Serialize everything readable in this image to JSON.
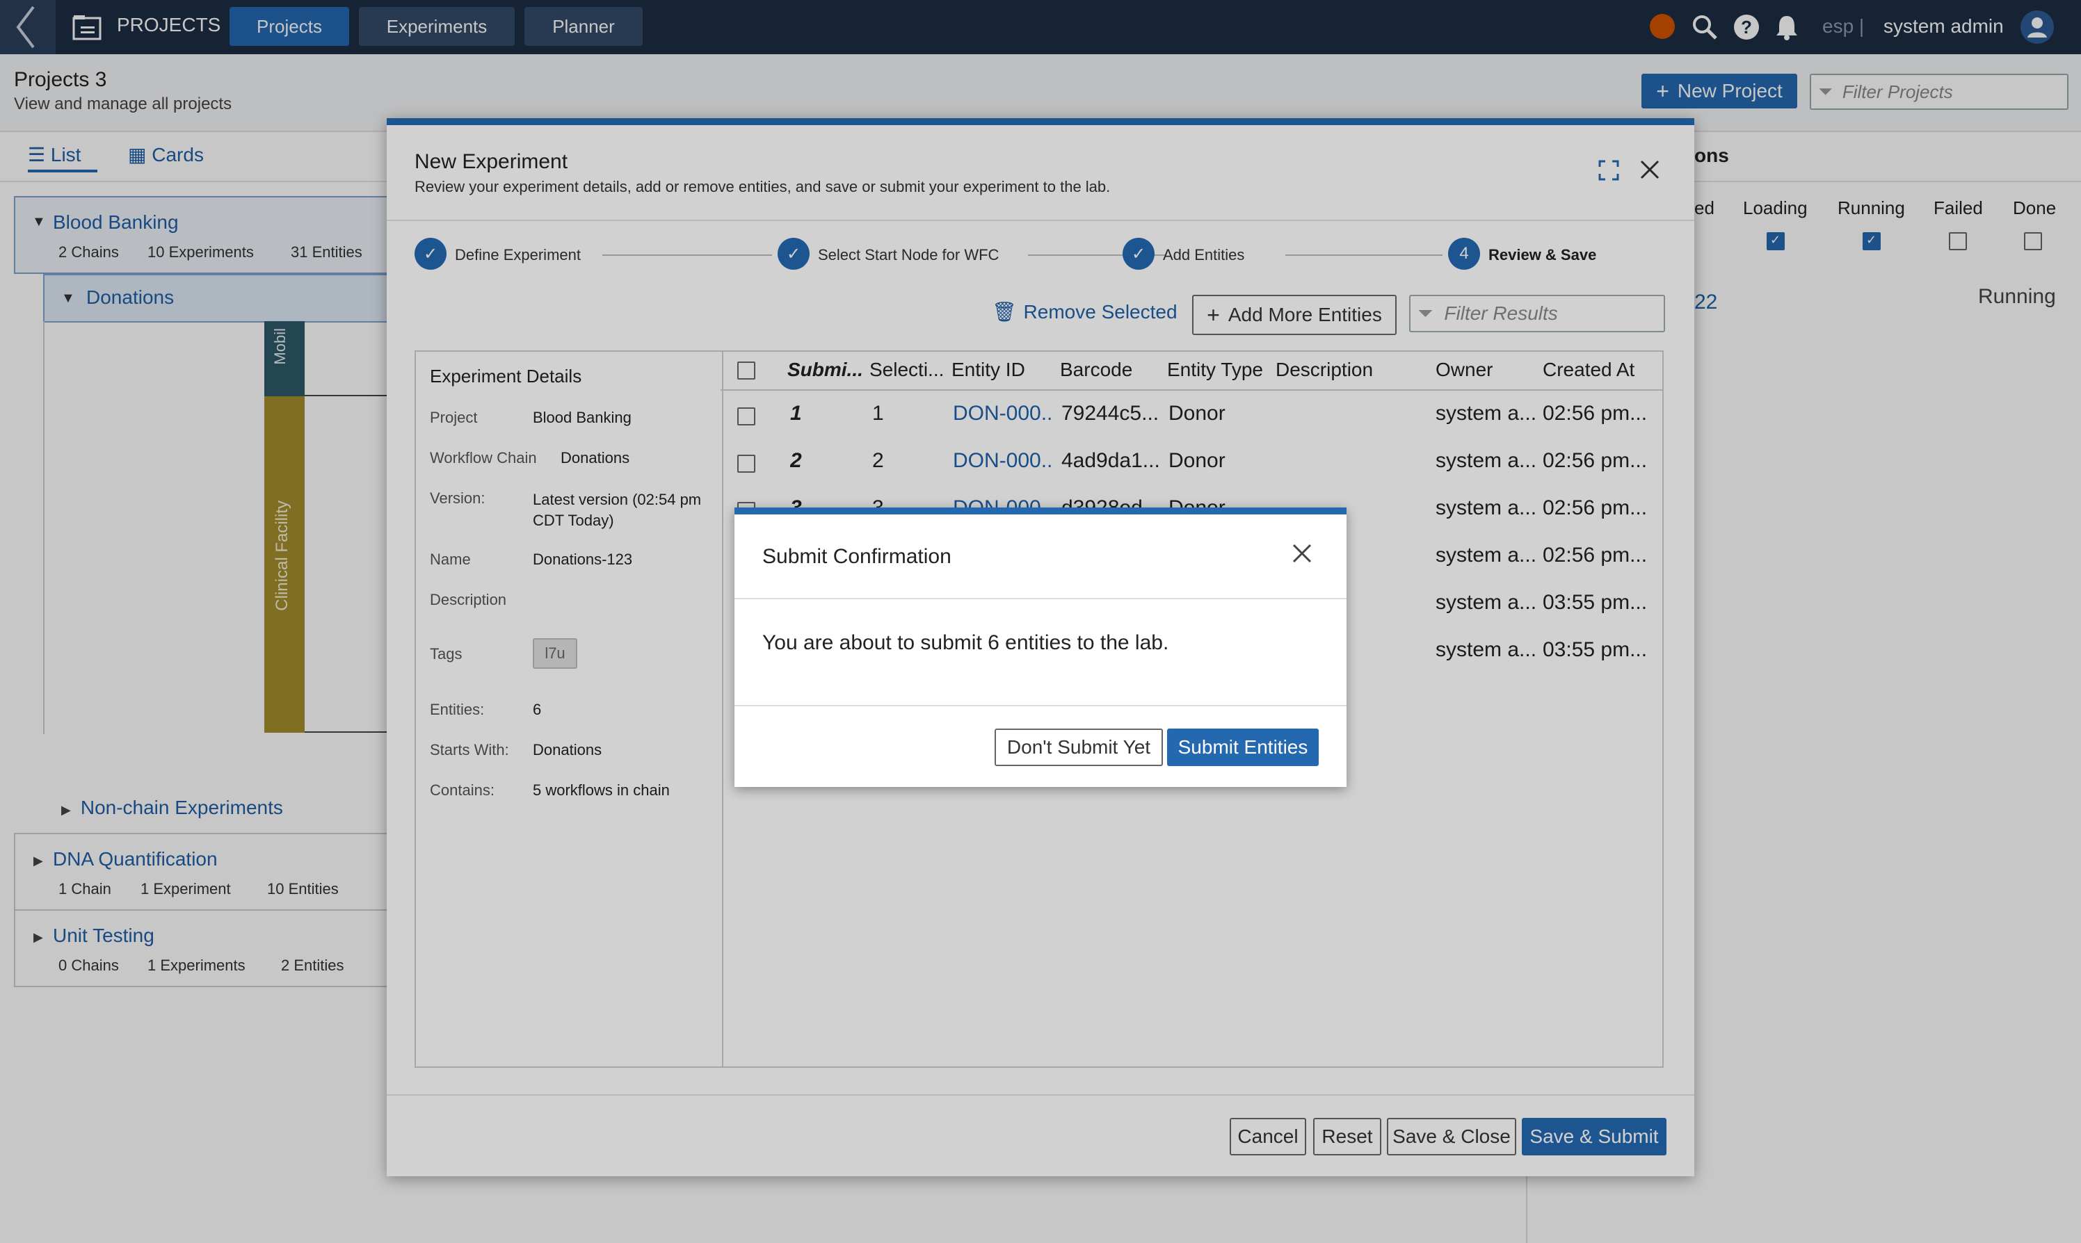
{
  "topbar": {
    "app_title": "PROJECTS",
    "tabs": [
      {
        "label": "Projects",
        "active": true
      },
      {
        "label": "Experiments",
        "active": false
      },
      {
        "label": "Planner",
        "active": false
      }
    ],
    "lang": "esp |",
    "user": "system admin",
    "status_color": "#d35400"
  },
  "page": {
    "title": "Projects 3",
    "subtitle": "View and manage all projects",
    "new_project": "New Project",
    "filter_placeholder": "Filter Projects",
    "view_tabs": [
      "List",
      "Cards"
    ]
  },
  "tree": {
    "blood_banking": {
      "name": "Blood Banking",
      "chains": "2 Chains",
      "experiments": "10 Experiments",
      "entities": "31 Entities"
    },
    "donations": "Donations",
    "lane_mobile": "Mobil",
    "lane_clinical": "Clinical Facility",
    "non_chain": "Non-chain Experiments",
    "dna": {
      "name": "DNA Quantification",
      "chains": "1 Chain",
      "experiments": "1 Experiment",
      "entities": "10 Entities"
    },
    "unit": {
      "name": "Unit Testing",
      "chains": "0 Chains",
      "experiments": "1 Experiments",
      "entities": "2 Entities"
    }
  },
  "right_panel": {
    "header": "ons",
    "cols": [
      "ed",
      "Loading",
      "Running",
      "Failed",
      "Done"
    ],
    "checked": [
      null,
      true,
      true,
      false,
      false
    ],
    "link": "22",
    "status": "Running"
  },
  "modal": {
    "title": "New Experiment",
    "subtitle": "Review your experiment details, add or remove entities, and save or submit your experiment to the lab.",
    "steps": [
      {
        "label": "Define Experiment",
        "done": true,
        "num": ""
      },
      {
        "label": "Select Start Node for WFC",
        "done": true,
        "num": ""
      },
      {
        "label": "Add Entities",
        "done": true,
        "num": ""
      },
      {
        "label": "Review & Save",
        "done": false,
        "num": "4"
      }
    ],
    "remove_selected": "Remove Selected",
    "add_more": "Add More Entities",
    "filter_placeholder": "Filter Results",
    "details": {
      "heading": "Experiment Details",
      "rows": [
        {
          "label": "Project",
          "value": "Blood Banking"
        },
        {
          "label": "Workflow Chain",
          "value": "Donations"
        },
        {
          "label": "Version:",
          "value": "Latest version (02:54 pm CDT Today)"
        },
        {
          "label": "Name",
          "value": "Donations-123"
        },
        {
          "label": "Description",
          "value": ""
        },
        {
          "label": "Tags",
          "value": "l7u"
        },
        {
          "label": "Entities:",
          "value": "6"
        },
        {
          "label": "Starts With:",
          "value": "Donations"
        },
        {
          "label": "Contains:",
          "value": "5 workflows in chain"
        }
      ]
    },
    "table": {
      "headers": [
        "Submi...",
        "Selecti...",
        "Entity ID",
        "Barcode",
        "Entity Type",
        "Description",
        "Owner",
        "Created At"
      ],
      "rows": [
        {
          "sub": "1",
          "sel": "1",
          "id": "DON-000...",
          "barcode": "79244c5...",
          "type": "Donor",
          "desc": "",
          "owner": "system a...",
          "created": "02:56 pm..."
        },
        {
          "sub": "2",
          "sel": "2",
          "id": "DON-000...",
          "barcode": "4ad9da1...",
          "type": "Donor",
          "desc": "",
          "owner": "system a...",
          "created": "02:56 pm..."
        },
        {
          "sub": "3",
          "sel": "3",
          "id": "DON-000...",
          "barcode": "d3928ed...",
          "type": "Donor",
          "desc": "",
          "owner": "system a...",
          "created": "02:56 pm..."
        },
        {
          "sub": "",
          "sel": "",
          "id": "",
          "barcode": "",
          "type": "",
          "desc": "",
          "owner": "system a...",
          "created": "02:56 pm..."
        },
        {
          "sub": "",
          "sel": "",
          "id": "",
          "barcode": "",
          "type": "",
          "desc": "",
          "owner": "system a...",
          "created": "03:55 pm..."
        },
        {
          "sub": "",
          "sel": "",
          "id": "",
          "barcode": "",
          "type": "",
          "desc": "",
          "owner": "system a...",
          "created": "03:55 pm..."
        }
      ]
    },
    "footer": {
      "cancel": "Cancel",
      "reset": "Reset",
      "save_close": "Save & Close",
      "save_submit": "Save & Submit"
    }
  },
  "dialog": {
    "title": "Submit Confirmation",
    "message": "You are about to submit 6 entities to the lab.",
    "dont_submit": "Don't Submit Yet",
    "submit": "Submit Entities"
  }
}
